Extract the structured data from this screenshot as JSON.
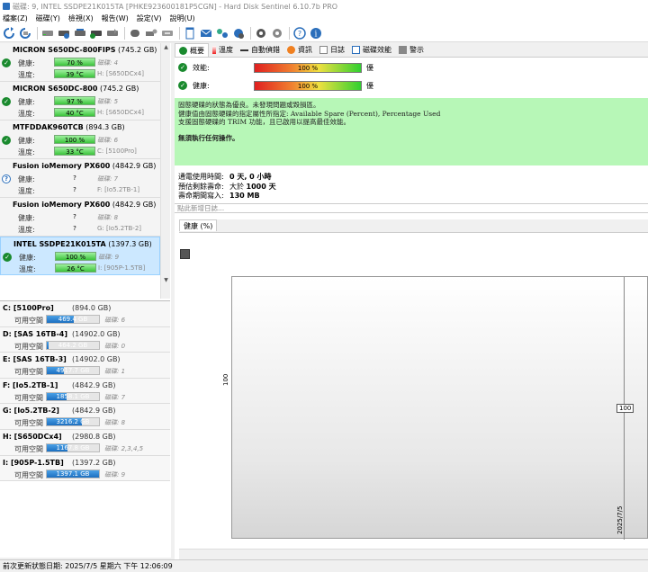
{
  "window": {
    "title": "磁碟: 9, INTEL SSDPE21K015TA [PHKE923600181P5CGN]  -  Hard Disk Sentinel 6.10.7b PRO"
  },
  "menu": [
    "檔案(Z)",
    "磁碟(Y)",
    "檢視(X)",
    "報告(W)",
    "設定(V)",
    "說明(U)"
  ],
  "toolbar_icons": [
    "refresh-icon",
    "refresh-disk-icon",
    "hdd-icon",
    "hdd-network-icon",
    "hdd-scan-icon",
    "hdd-check-icon",
    "hdd-test-icon",
    "hdd-dark-icon",
    "hdd-remote-icon",
    "hdd-usb-icon",
    "notepad-icon",
    "mail-icon",
    "network-icon",
    "network-globe-icon",
    "gear-icon",
    "gear-check-icon",
    "help-icon",
    "info-icon"
  ],
  "disks": [
    {
      "name": "MICRON  S650DC-800FIPS",
      "size": "(745.2 GB)",
      "health_label": "健康:",
      "health": "70 %",
      "health_pct": 70,
      "health_side": "磁碟: 4",
      "temp_label": "溫度:",
      "temp": "39 °C",
      "temp_side": "H: [S650DCx4]",
      "status": "ok"
    },
    {
      "name": "MICRON  S650DC-800",
      "size": "(745.2 GB)",
      "health_label": "健康:",
      "health": "97 %",
      "health_pct": 97,
      "health_side": "磁碟: 5",
      "temp_label": "溫度:",
      "temp": "40 °C",
      "temp_side": "H: [S650DCx4]",
      "status": "ok"
    },
    {
      "name": "MTFDDAK960TCB",
      "size": "(894.3 GB)",
      "health_label": "健康:",
      "health": "100 %",
      "health_pct": 100,
      "health_side": "磁碟: 6",
      "temp_label": "溫度:",
      "temp": "33 °C",
      "temp_side": "C: [5100Pro]",
      "status": "ok"
    },
    {
      "name": "Fusion  ioMemory PX600",
      "size": "(4842.9 GB)",
      "health_label": "健康:",
      "health": "?",
      "health_pct": 0,
      "health_side": "磁碟: 7",
      "temp_label": "溫度:",
      "temp": "?",
      "temp_side": "F: [Io5.2TB-1]",
      "status": "unknown"
    },
    {
      "name": "Fusion  ioMemory PX600",
      "size": "(4842.9 GB)",
      "health_label": "健康:",
      "health": "?",
      "health_pct": 0,
      "health_side": "磁碟: 8",
      "temp_label": "溫度:",
      "temp": "?",
      "temp_side": "G: [Io5.2TB-2]",
      "status": "none"
    },
    {
      "name": "INTEL SSDPE21K015TA",
      "size": "(1397.3 GB)",
      "health_label": "健康:",
      "health": "100 %",
      "health_pct": 100,
      "health_side": "磁碟: 9",
      "temp_label": "溫度:",
      "temp": "26 °C",
      "temp_side": "I: [905P-1.5TB]",
      "status": "ok"
    }
  ],
  "volumes": [
    {
      "name": "C: [5100Pro]",
      "size": "(894.0 GB)",
      "free_label": "可用空間",
      "free": "469.4 GB",
      "free_pct": 52.5,
      "disk": "磁碟: 6"
    },
    {
      "name": "D: [SAS 16TB-4]",
      "size": "(14902.0 GB)",
      "free_label": "可用空間",
      "free": "464.2 GB",
      "free_pct": 3.1,
      "disk": "磁碟: 0"
    },
    {
      "name": "E: [SAS 16TB-3]",
      "size": "(14902.0 GB)",
      "free_label": "可用空間",
      "free": "4917.7 GB",
      "free_pct": 33,
      "disk": "磁碟: 1"
    },
    {
      "name": "F: [Io5.2TB-1]",
      "size": "(4842.9 GB)",
      "free_label": "可用空間",
      "free": "1858.1 GB",
      "free_pct": 38.4,
      "disk": "磁碟: 7"
    },
    {
      "name": "G: [Io5.2TB-2]",
      "size": "(4842.9 GB)",
      "free_label": "可用空間",
      "free": "3216.2 GB",
      "free_pct": 66.4,
      "disk": "磁碟: 8"
    },
    {
      "name": "H: [S650DCx4]",
      "size": "(2980.8 GB)",
      "free_label": "可用空間",
      "free": "1167.8 GB",
      "free_pct": 39.2,
      "disk": "磁碟: 2,3,4,5"
    },
    {
      "name": "I: [905P-1.5TB]",
      "size": "(1397.2 GB)",
      "free_label": "可用空間",
      "free": "1397.1 GB",
      "free_pct": 100,
      "disk": "磁碟: 9"
    }
  ],
  "tabs": [
    "概要",
    "溫度",
    "自動偵錯",
    "資訊",
    "日誌",
    "磁碟效能",
    "警示"
  ],
  "performance": {
    "label": "效能:",
    "value": "100 %",
    "pct": 100,
    "result": "優"
  },
  "health": {
    "label": "健康:",
    "value": "100 %",
    "pct": 100,
    "result": "優"
  },
  "status_text": {
    "line1": "固態硬碟的狀態為優良。未發現問題或毀損區。",
    "line2": "健康值由固態硬碟的指定屬性所指定:  Available Spare (Percent), Percentage Used",
    "line3": "支援固態硬碟的 TRIM 功能，且已啟用以提高最佳效能。",
    "action": "無須執行任何操作。"
  },
  "stats": {
    "power_on_label": "通電使用時間:",
    "power_on": "0 天, 0 小時",
    "remaining_label": "預估剩餘壽命:",
    "remaining_prefix": "大於",
    "remaining": "1000 天",
    "written_label": "壽命期間寫入:",
    "written": "130 MB"
  },
  "log_placeholder": "點此新增日誌...",
  "chart_data": {
    "type": "line",
    "title": "健康 (%)",
    "ylabel": "100",
    "x": [
      "2025/7/5"
    ],
    "series": [
      {
        "values": [
          100
        ]
      }
    ],
    "point_label": "100"
  },
  "statusbar": "前次更新狀態日期: 2025/7/5 星期六 下午 12:06:09",
  "colors": {
    "selected": "#cce8ff",
    "status_ok": "#b7f7b7",
    "bar_blue": "#1c6fc0"
  }
}
